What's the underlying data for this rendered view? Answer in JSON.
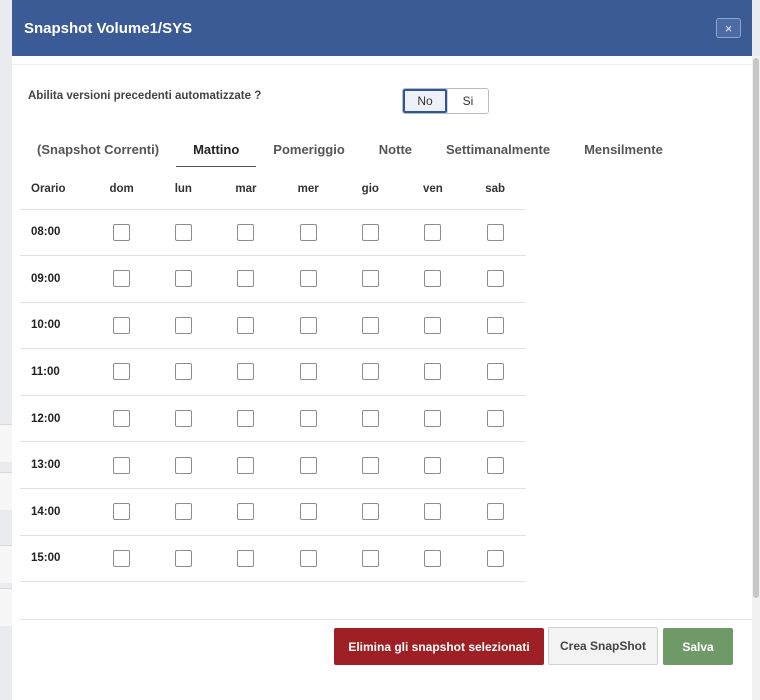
{
  "modal": {
    "title": "Snapshot Volume1/SYS",
    "close_label": "×"
  },
  "setting": {
    "label": "Abilita versioni precedenti automatizzate ?",
    "options": [
      "No",
      "Si"
    ],
    "selected": "No"
  },
  "tabs": [
    {
      "label": "(Snapshot Correnti)",
      "active": false
    },
    {
      "label": "Mattino",
      "active": true
    },
    {
      "label": "Pomeriggio",
      "active": false
    },
    {
      "label": "Notte",
      "active": false
    },
    {
      "label": "Settimanalmente",
      "active": false
    },
    {
      "label": "Mensilmente",
      "active": false
    }
  ],
  "schedule": {
    "time_header": "Orario",
    "days": [
      "dom",
      "lun",
      "mar",
      "mer",
      "gio",
      "ven",
      "sab"
    ],
    "times": [
      "08:00",
      "09:00",
      "10:00",
      "11:00",
      "12:00",
      "13:00",
      "14:00",
      "15:00"
    ]
  },
  "footer": {
    "delete_label": "Elimina gli snapshot selezionati",
    "create_label": "Crea SnapShot",
    "save_label": "Salva"
  },
  "colors": {
    "header": "#3b5b97",
    "delete": "#9e1f24",
    "save": "#6f9a68"
  }
}
